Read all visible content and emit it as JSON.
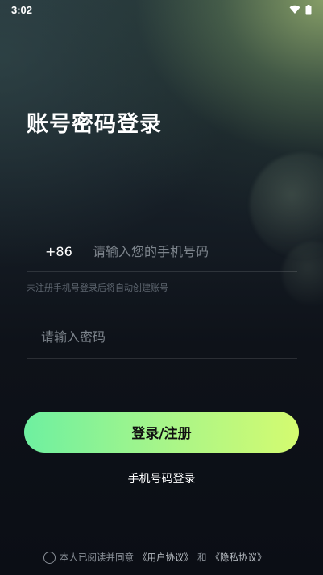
{
  "status_bar": {
    "time": "3:02",
    "icons": [
      "wifi-icon",
      "battery-icon"
    ]
  },
  "page": {
    "title": "账号密码登录"
  },
  "phone_field": {
    "country_code": "+86",
    "placeholder": "请输入您的手机号码",
    "value": ""
  },
  "hint": "未注册手机号登录后将自动创建账号",
  "password_field": {
    "placeholder": "请输入密码",
    "value": ""
  },
  "login_button": {
    "label": "登录/注册"
  },
  "alt_login": {
    "label": "手机号码登录"
  },
  "agreement": {
    "prefix": "本人已阅读并同意",
    "user_agreement": "《用户协议》",
    "conjunction": "和",
    "privacy_agreement": "《隐私协议》",
    "checked": false
  },
  "colors": {
    "accent_start": "#6ef0a0",
    "accent_end": "#d4fb70",
    "background": "#0d1118"
  }
}
